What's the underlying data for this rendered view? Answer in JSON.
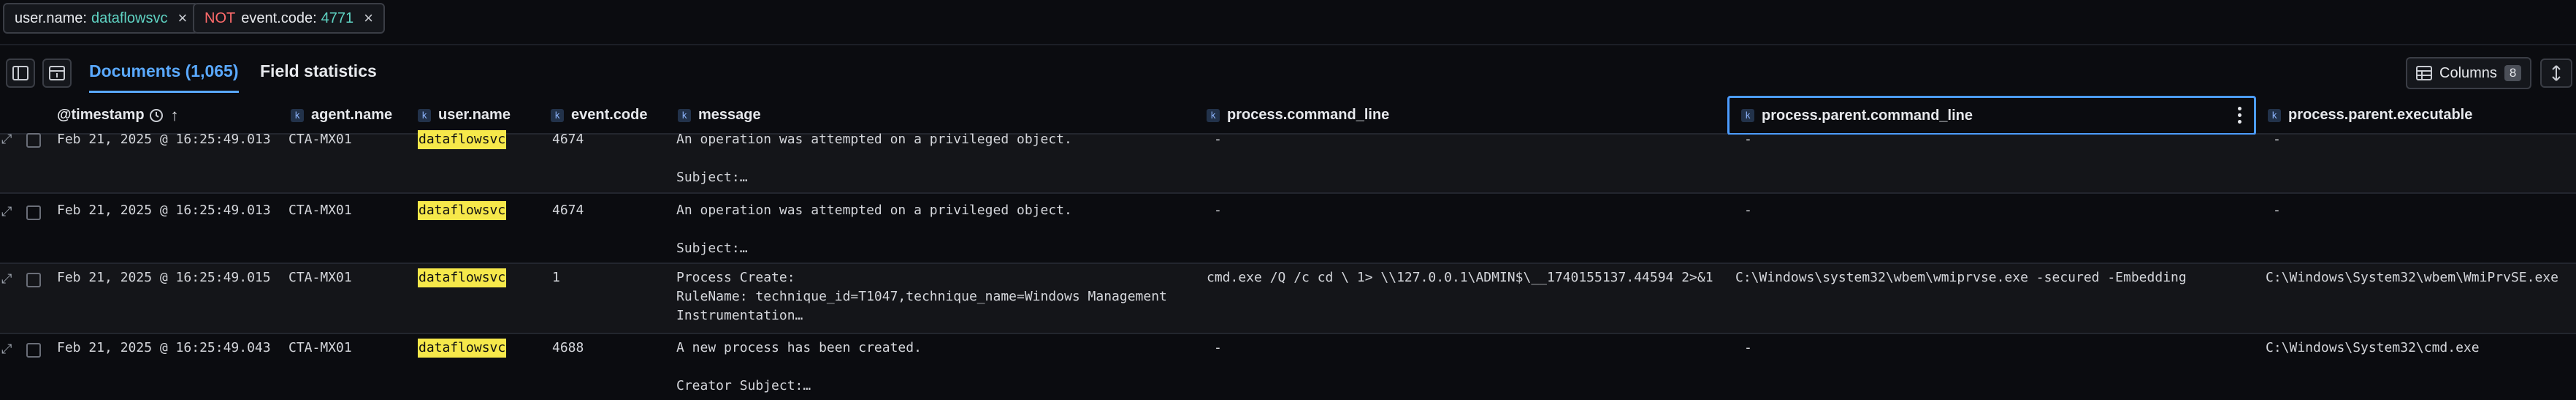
{
  "filters": [
    {
      "field": "user.name:",
      "value": "dataflowsvc",
      "negated": false,
      "close": "×"
    },
    {
      "negation": "NOT",
      "field": "event.code:",
      "value": "4771",
      "negated": true,
      "close": "×"
    }
  ],
  "toolbar": {
    "tab_documents": "Documents (1,065)",
    "tab_field_stats": "Field statistics",
    "columns_label": "Columns",
    "columns_count": "8"
  },
  "columns": {
    "timestamp": "@timestamp",
    "agent_name": "agent.name",
    "user_name": "user.name",
    "event_code": "event.code",
    "message": "message",
    "process_command_line": "process.command_line",
    "process_parent_command_line": "process.parent.command_line",
    "process_parent_executable": "process.parent.executable",
    "type_glyph": "k",
    "sort_indicator": "↑"
  },
  "rows": [
    {
      "timestamp": "Feb 21, 2025 @ 16:25:49.013",
      "agent": "CTA-MX01",
      "user": "dataflowsvc",
      "code": "4674",
      "message_l1": "An operation was attempted on a privileged object.",
      "message_l2": "",
      "message_l3": "Subject:…",
      "cmd": "-",
      "parent_cmd": "-",
      "parent_exe": "-"
    },
    {
      "timestamp": "Feb 21, 2025 @ 16:25:49.013",
      "agent": "CTA-MX01",
      "user": "dataflowsvc",
      "code": "4674",
      "message_l1": "An operation was attempted on a privileged object.",
      "message_l2": "",
      "message_l3": "Subject:…",
      "cmd": "-",
      "parent_cmd": "-",
      "parent_exe": "-"
    },
    {
      "timestamp": "Feb 21, 2025 @ 16:25:49.015",
      "agent": "CTA-MX01",
      "user": "dataflowsvc",
      "code": "1",
      "message_l1": "Process Create:",
      "message_l2": "RuleName: technique_id=T1047,technique_name=Windows Management",
      "message_l3": "Instrumentation…",
      "cmd": "cmd.exe /Q /c cd \\ 1> \\\\127.0.0.1\\ADMIN$\\__1740155137.44594 2>&1",
      "parent_cmd": "C:\\Windows\\system32\\wbem\\wmiprvse.exe -secured -Embedding",
      "parent_exe": "C:\\Windows\\System32\\wbem\\WmiPrvSE.exe"
    },
    {
      "timestamp": "Feb 21, 2025 @ 16:25:49.043",
      "agent": "CTA-MX01",
      "user": "dataflowsvc",
      "code": "4688",
      "message_l1": "A new process has been created.",
      "message_l2": "",
      "message_l3": "Creator Subject:…",
      "cmd": "-",
      "parent_cmd": "-",
      "parent_exe": "C:\\Windows\\System32\\cmd.exe"
    }
  ],
  "colors": {
    "accent": "#5aa9ff",
    "filter_value": "#5fd3c3",
    "negation": "#ff6b6b",
    "highlight": "#f6e84a"
  }
}
